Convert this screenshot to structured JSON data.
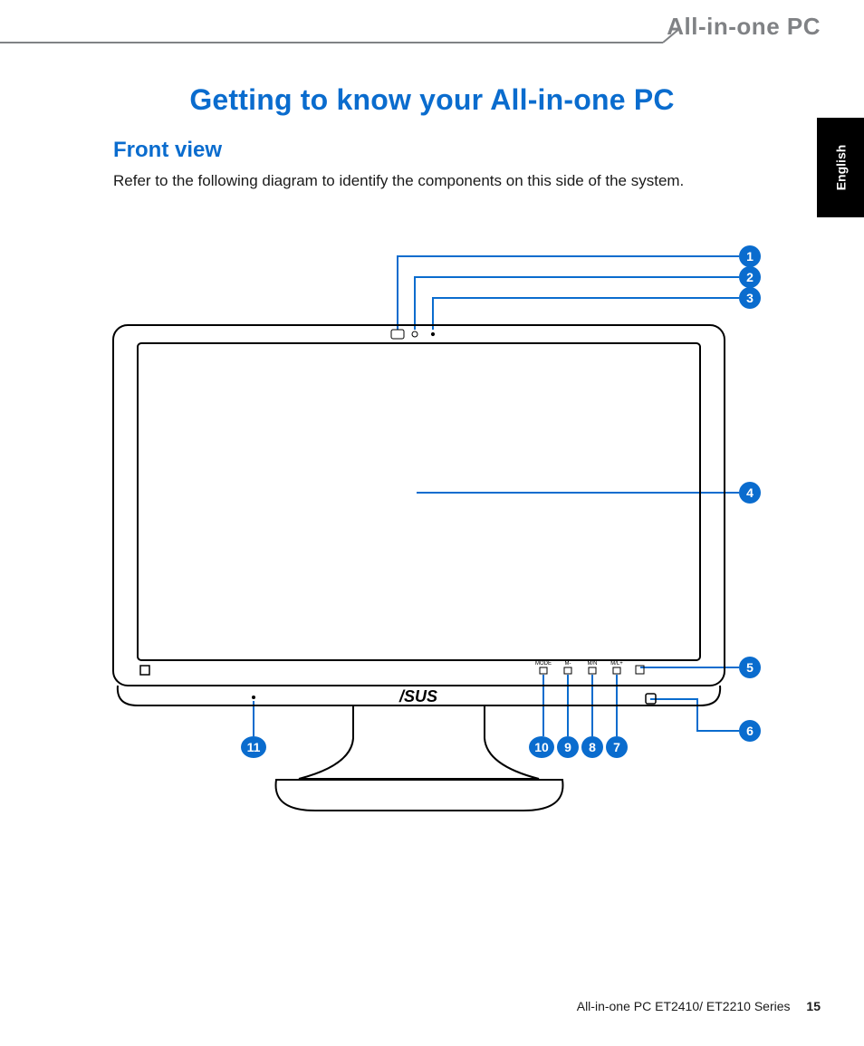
{
  "header": {
    "brand_title": "All-in-one PC"
  },
  "language_tab": "English",
  "title": "Getting to know your All-in-one PC",
  "section": "Front view",
  "intro": "Refer to the following diagram to identify the components on this side of the system.",
  "diagram": {
    "brand_logo_text": "/SUS",
    "bezel_buttons": [
      "MODE",
      "M-",
      "M/N",
      "M/L+",
      ""
    ],
    "callouts": [
      "1",
      "2",
      "3",
      "4",
      "5",
      "6",
      "7",
      "8",
      "9",
      "10",
      "11"
    ]
  },
  "footer": {
    "model_line": "All-in-one PC ET2410/ ET2210 Series",
    "page_number": "15"
  }
}
